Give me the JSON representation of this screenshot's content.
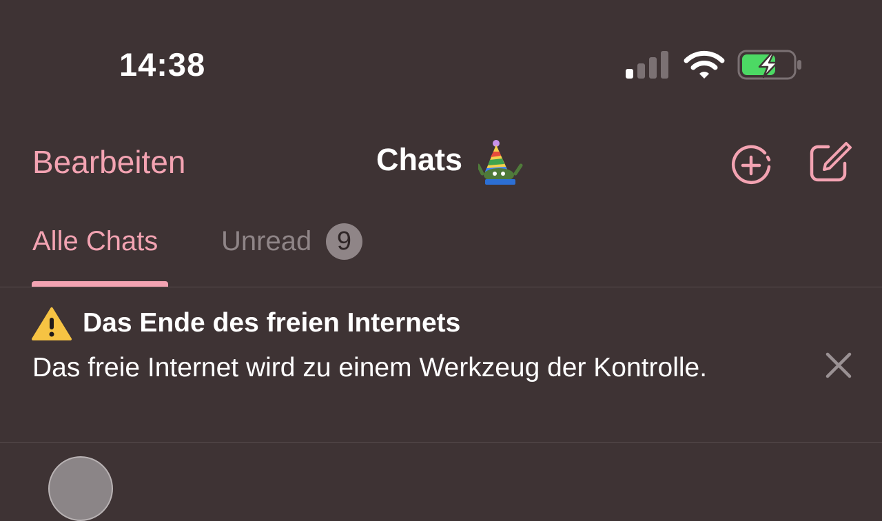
{
  "status_bar": {
    "time": "14:38",
    "signal_icon": "cellular-signal-icon",
    "wifi_icon": "wifi-icon",
    "battery_icon": "battery-charging-icon",
    "battery_color": "#4cd964"
  },
  "nav": {
    "edit_label": "Bearbeiten",
    "title": "Chats",
    "title_emoji_icon": "party-hat-frog-icon",
    "new_story_icon": "add-story-icon",
    "compose_icon": "compose-icon"
  },
  "tabs": [
    {
      "label": "Alle Chats",
      "active": true
    },
    {
      "label": "Unread",
      "active": false,
      "badge": "9"
    }
  ],
  "banner": {
    "icon": "warning-icon",
    "title": "Das Ende des freien Internets",
    "text": "Das freie Internet wird zu einem Werkzeug der Kontrolle.",
    "close_icon": "close-icon"
  },
  "colors": {
    "background": "#3e3334",
    "accent": "#f3a3b2",
    "muted": "#8f8587"
  }
}
